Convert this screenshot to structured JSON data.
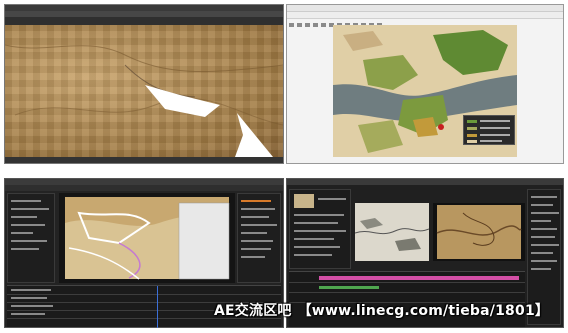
{
  "screens": {
    "photoshop": {
      "name": "image-editor"
    },
    "map_viewer": {
      "name": "map-viewer"
    },
    "after_effects": {
      "name": "compositing-app"
    },
    "premiere": {
      "name": "video-editor"
    }
  },
  "watermark": {
    "brand": "AE交流区吧",
    "url": "【www.linecg.com/tieba/1801】"
  },
  "colors": {
    "pink_track": "#d34fa6",
    "green_track": "#4fa64f",
    "map_land": "#6b8f3a",
    "map_water": "#6a7a7c"
  }
}
